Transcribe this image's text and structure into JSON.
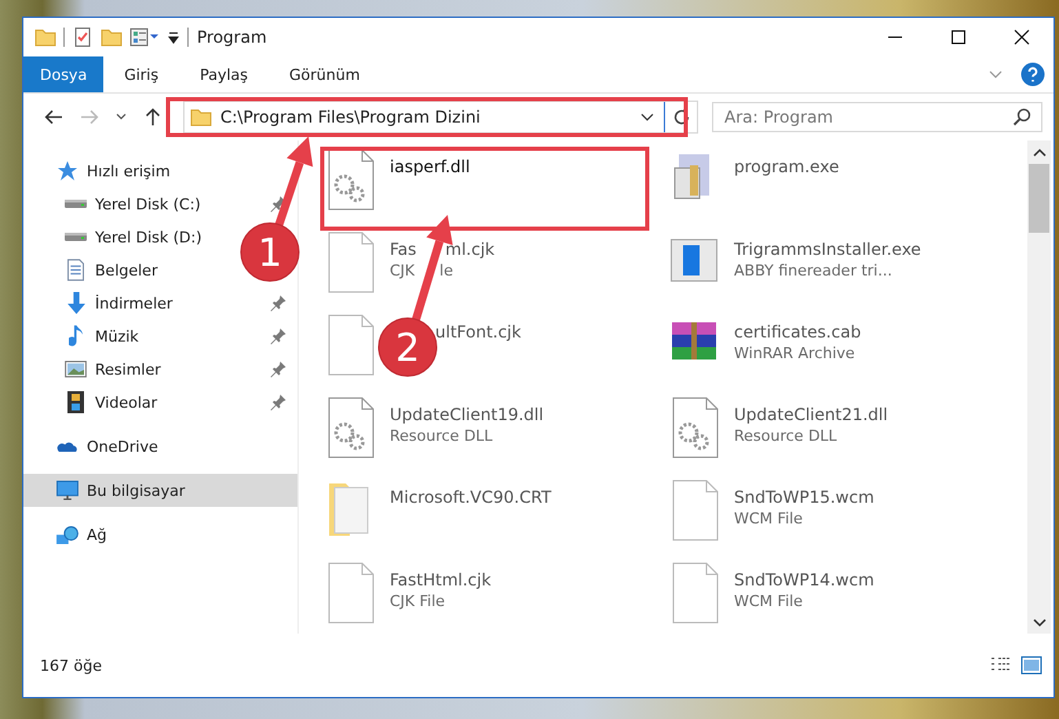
{
  "window": {
    "title": "Program"
  },
  "ribbon_tabs": [
    {
      "label": "Dosya",
      "selected": true
    },
    {
      "label": "Giriş",
      "selected": false
    },
    {
      "label": "Paylaş",
      "selected": false
    },
    {
      "label": "Görünüm",
      "selected": false
    }
  ],
  "address_bar": {
    "path": "C:\\Program Files\\Program Dizini"
  },
  "search": {
    "placeholder": "Ara: Program"
  },
  "navigation": [
    {
      "label": "Hızlı erişim",
      "kind": "star",
      "selected": false,
      "children": [
        {
          "label": "Yerel Disk (C:)",
          "kind": "drive",
          "selected": false,
          "pinned": true
        },
        {
          "label": "Yerel Disk (D:)",
          "kind": "drive",
          "selected": false,
          "pinned": false
        },
        {
          "label": "Belgeler",
          "kind": "documents",
          "selected": false,
          "pinned": false
        },
        {
          "label": "İndirmeler",
          "kind": "downloads",
          "selected": false,
          "pinned": true
        },
        {
          "label": "Müzik",
          "kind": "music",
          "selected": false,
          "pinned": true
        },
        {
          "label": "Resimler",
          "kind": "pictures",
          "selected": false,
          "pinned": true
        },
        {
          "label": "Videolar",
          "kind": "videos",
          "selected": false,
          "pinned": true
        }
      ]
    },
    {
      "label": "OneDrive",
      "kind": "cloud",
      "selected": false
    },
    {
      "label": "Bu bilgisayar",
      "kind": "computer",
      "selected": true
    },
    {
      "label": "Ağ",
      "kind": "network",
      "selected": false
    }
  ],
  "files": [
    {
      "name_parts": [
        "iasperf.dll"
      ],
      "kind": "dll",
      "focused": true
    },
    {
      "name_parts": [
        "program.exe"
      ],
      "kind": "exe",
      "focused": false
    },
    {
      "name_parts": [
        "Fas",
        "ml.cjk"
      ],
      "type_parts": [
        "CJK",
        "le"
      ],
      "kind": "document",
      "focused": false
    },
    {
      "name_parts": [
        "TrigrammsInstaller.exe"
      ],
      "type_parts": [
        "ABBY finereader tri..."
      ],
      "kind": "installer",
      "focused": false
    },
    {
      "name_parts": [
        "ultFont.cjk"
      ],
      "name_start_hidden": true,
      "kind": "document",
      "focused": false
    },
    {
      "name_parts": [
        "certificates.cab"
      ],
      "type_parts": [
        "WinRAR Archive"
      ],
      "kind": "archive",
      "focused": false
    },
    {
      "name_parts": [
        "UpdateClient19.dll"
      ],
      "type_parts": [
        "Resource DLL"
      ],
      "kind": "dll",
      "focused": false
    },
    {
      "name_parts": [
        "UpdateClient21.dll"
      ],
      "type_parts": [
        "Resource DLL"
      ],
      "kind": "dll",
      "focused": false
    },
    {
      "name_parts": [
        "Microsoft.VC90.CRT"
      ],
      "kind": "folder",
      "focused": false
    },
    {
      "name_parts": [
        "SndToWP15.wcm"
      ],
      "type_parts": [
        "WCM File"
      ],
      "kind": "document",
      "focused": false
    },
    {
      "name_parts": [
        "FastHtml.cjk"
      ],
      "type_parts": [
        "CJK File"
      ],
      "kind": "document",
      "focused": false
    },
    {
      "name_parts": [
        "SndToWP14.wcm"
      ],
      "type_parts": [
        "WCM File"
      ],
      "kind": "document",
      "focused": false
    }
  ],
  "status_bar": {
    "item_count": "167 öğe"
  },
  "annotations": [
    {
      "label": "1",
      "kind": "address_bar"
    },
    {
      "label": "2",
      "kind": "file"
    }
  ]
}
